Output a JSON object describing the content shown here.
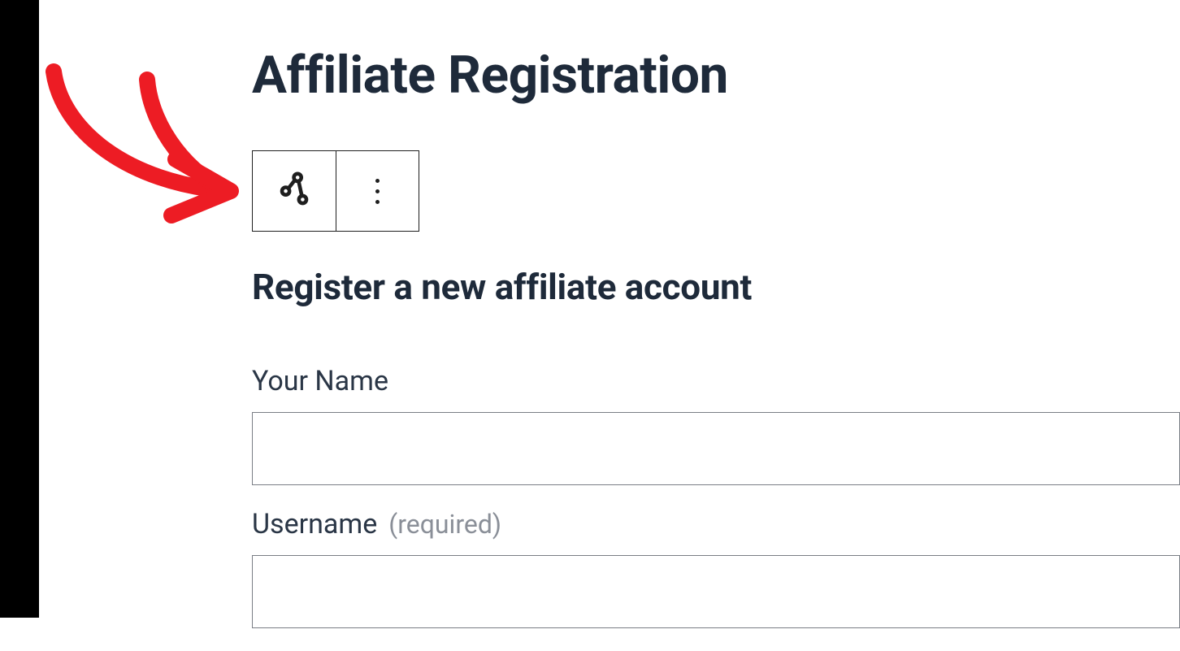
{
  "page": {
    "title": "Affiliate Registration",
    "subheading": "Register a new affiliate account"
  },
  "toolbar": {
    "block_icon_name": "affiliate-block-icon",
    "more_icon_name": "more-vertical-icon"
  },
  "form": {
    "fields": [
      {
        "label": "Your Name",
        "required_hint": "",
        "value": ""
      },
      {
        "label": "Username",
        "required_hint": "(required)",
        "value": ""
      }
    ]
  },
  "annotation": {
    "color": "#ed1c24"
  }
}
